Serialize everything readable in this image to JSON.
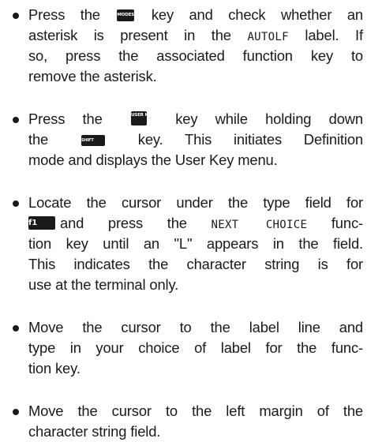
{
  "keys": {
    "modes": "MODES",
    "user_keys": "USER KEYS",
    "shift": "SHIFT",
    "f1": "f1"
  },
  "bullets": [
    {
      "lines": {
        "l1a": "Press the",
        "l1b": "key and check whether an",
        "l2a": "asterisk is present in the",
        "l2code": "AUTOLF",
        "l2b": "label. If",
        "l3": "so, press the associated function key to",
        "l4": "remove the asterisk."
      }
    },
    {
      "lines": {
        "l1a": "Press the",
        "l1b": "key while holding down",
        "l2a": "the",
        "l2b": "key. This initiates Definition",
        "l3": "mode and displays the User Key menu."
      }
    },
    {
      "lines": {
        "l1": "Locate the cursor under the type field for",
        "l2code": "NEXT CHOICE",
        "l2a": "and press the",
        "l2b": "func-",
        "l3": "tion key until an \"L\" appears in the field.",
        "l4": "This indicates the character string is for",
        "l5": "use at the terminal only."
      }
    },
    {
      "lines": {
        "l1": "Move the cursor to the label line and",
        "l2": "type in your choice of label for the func-",
        "l3": "tion key."
      }
    },
    {
      "lines": {
        "l1": "Move the cursor to the left margin of the",
        "l2": "character string field."
      }
    }
  ]
}
